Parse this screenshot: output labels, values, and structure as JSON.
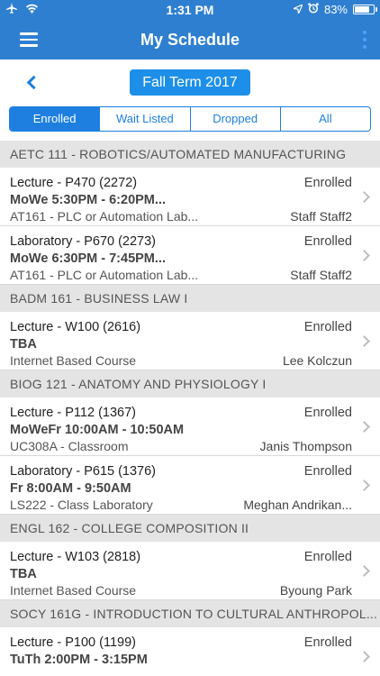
{
  "status_bar": {
    "time": "1:31 PM",
    "battery": "83%",
    "battery_level": 0.83
  },
  "nav": {
    "title": "My Schedule"
  },
  "term": {
    "label": "Fall Term 2017"
  },
  "tabs": [
    {
      "label": "Enrolled",
      "active": true
    },
    {
      "label": "Wait Listed",
      "active": false
    },
    {
      "label": "Dropped",
      "active": false
    },
    {
      "label": "All",
      "active": false
    }
  ],
  "courses": [
    {
      "title": "AETC 111 - ROBOTICS/AUTOMATED MANUFACTURING",
      "sections": [
        {
          "title": "Lecture - P470 (2272)",
          "status": "Enrolled",
          "time": "MoWe 5:30PM - 6:20PM...",
          "location": "AT161 - PLC or Automation Lab...",
          "instructor": "Staff Staff2"
        },
        {
          "title": "Laboratory - P670 (2273)",
          "status": "Enrolled",
          "time": "MoWe 6:30PM - 7:45PM...",
          "location": "AT161 - PLC or Automation Lab...",
          "instructor": "Staff Staff2"
        }
      ]
    },
    {
      "title": "BADM 161 - BUSINESS LAW I",
      "sections": [
        {
          "title": "Lecture - W100 (2616)",
          "status": "Enrolled",
          "time": "TBA",
          "location": "Internet Based Course",
          "instructor": "Lee Kolczun"
        }
      ]
    },
    {
      "title": "BIOG 121 - ANATOMY AND PHYSIOLOGY I",
      "sections": [
        {
          "title": "Lecture - P112 (1367)",
          "status": "Enrolled",
          "time": "MoWeFr 10:00AM - 10:50AM",
          "location": "UC308A - Classroom",
          "instructor": "Janis Thompson"
        },
        {
          "title": "Laboratory - P615 (1376)",
          "status": "Enrolled",
          "time": "Fr 8:00AM - 9:50AM",
          "location": "LS222 - Class Laboratory",
          "instructor": "Meghan Andrikan..."
        }
      ]
    },
    {
      "title": "ENGL 162 - COLLEGE COMPOSITION II",
      "sections": [
        {
          "title": "Lecture - W103 (2818)",
          "status": "Enrolled",
          "time": "TBA",
          "location": "Internet Based Course",
          "instructor": "Byoung Park"
        }
      ]
    },
    {
      "title": "SOCY 161G - INTRODUCTION TO CULTURAL ANTHROPOL...",
      "sections": [
        {
          "title": "Lecture - P100 (1199)",
          "status": "Enrolled",
          "time": "TuTh 2:00PM - 3:15PM",
          "location": "",
          "instructor": ""
        }
      ]
    }
  ]
}
